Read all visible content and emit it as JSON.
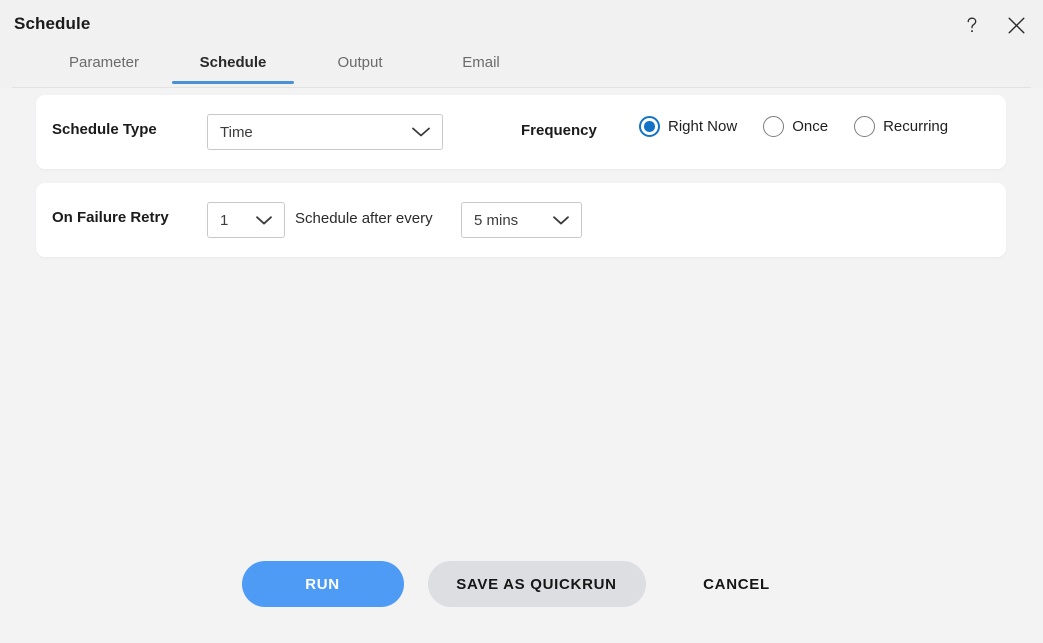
{
  "window": {
    "title": "Schedule",
    "help_icon": "question-mark-icon",
    "close_icon": "close-icon"
  },
  "tabs": [
    {
      "label": "Parameter",
      "active": false
    },
    {
      "label": "Schedule",
      "active": true
    },
    {
      "label": "Output",
      "active": false
    },
    {
      "label": "Email",
      "active": false
    }
  ],
  "schedule_type": {
    "label": "Schedule Type",
    "value": "Time",
    "chevron_icon": "chevron-down-icon"
  },
  "frequency": {
    "label": "Frequency",
    "options": [
      {
        "label": "Right Now",
        "selected": true
      },
      {
        "label": "Once",
        "selected": false
      },
      {
        "label": "Recurring",
        "selected": false
      }
    ]
  },
  "retry": {
    "label": "On Failure Retry",
    "count_value": "1",
    "interval_label": "Schedule after every",
    "interval_value": "5 mins",
    "chevron_icon": "chevron-down-icon"
  },
  "footer": {
    "run_label": "RUN",
    "quickrun_label": "SAVE AS QUICKRUN",
    "cancel_label": "CANCEL"
  },
  "colors": {
    "accent_blue": "#4d9bf5",
    "radio_blue": "#1273c6",
    "tab_underline": "#4a90d9",
    "quickrun_gray": "#dcdee1",
    "page_background": "#f3f3f4",
    "card_background": "#ffffff"
  }
}
